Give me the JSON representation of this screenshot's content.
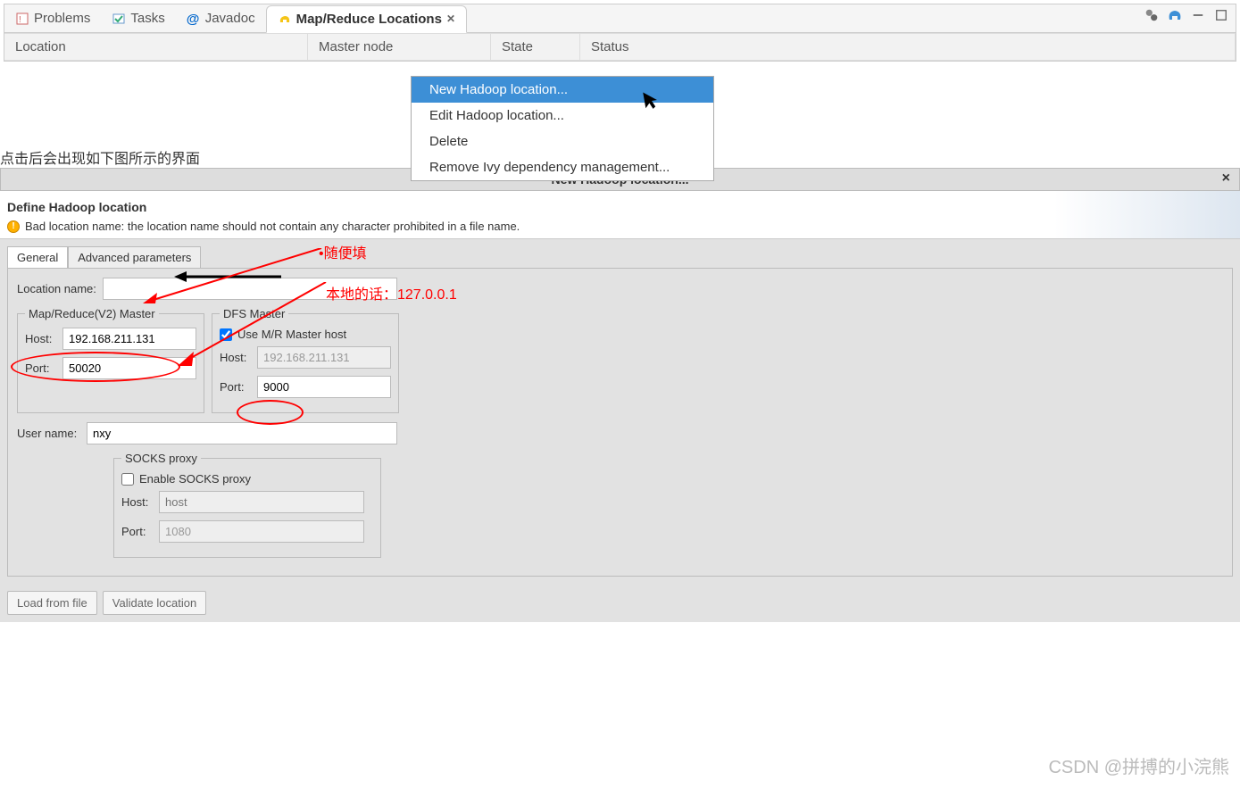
{
  "top_tabs": {
    "problems": "Problems",
    "tasks": "Tasks",
    "javadoc": "Javadoc",
    "mapreduce": "Map/Reduce Locations"
  },
  "table_headers": {
    "location": "Location",
    "master": "Master node",
    "state": "State",
    "status": "Status"
  },
  "context_menu": {
    "new_loc": "New Hadoop location...",
    "edit_loc": "Edit Hadoop location...",
    "delete": "Delete",
    "remove_ivy": "Remove Ivy dependency management..."
  },
  "caption": "点击后会出现如下图所示的界面",
  "dialog": {
    "title": "New Hadoop location...",
    "header_title": "Define Hadoop location",
    "warning_msg": "Bad location name: the location name should not contain any character prohibited in a file name.",
    "tabs": {
      "general": "General",
      "advanced": "Advanced parameters"
    },
    "location_name_label": "Location name:",
    "location_name_value": "",
    "mr_legend": "Map/Reduce(V2) Master",
    "dfs_legend": "DFS Master",
    "host_label": "Host:",
    "port_label": "Port:",
    "mr_host": "192.168.211.131",
    "mr_port": "50020",
    "use_mr_master": "Use M/R Master host",
    "dfs_host": "192.168.211.131",
    "dfs_port": "9000",
    "user_label": "User name:",
    "user_value": "nxy",
    "socks_legend": "SOCKS proxy",
    "enable_socks": "Enable SOCKS proxy",
    "socks_host_placeholder": "host",
    "socks_port": "1080",
    "btn_load": "Load from file",
    "btn_validate": "Validate location"
  },
  "annotations": {
    "a1": "随便填",
    "a2": "本地的话：127.0.0.1"
  },
  "watermark": "CSDN @拼搏的小浣熊"
}
